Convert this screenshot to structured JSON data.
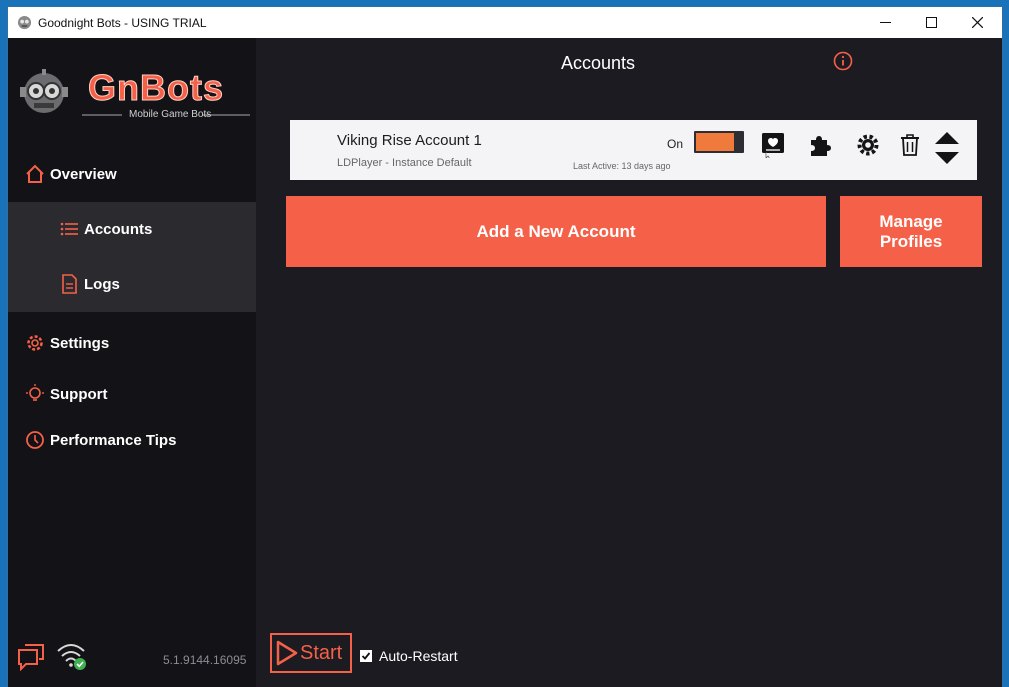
{
  "window": {
    "title": "Goodnight Bots  - USING TRIAL"
  },
  "logo": {
    "text": "GnBots",
    "tagline": "Mobile Game Bots"
  },
  "sidebar": {
    "items": [
      {
        "label": "Overview",
        "icon": "home-icon"
      },
      {
        "label": "Accounts",
        "icon": "list-icon"
      },
      {
        "label": "Logs",
        "icon": "document-icon"
      },
      {
        "label": "Settings",
        "icon": "gear-icon"
      },
      {
        "label": "Support",
        "icon": "lightbulb-icon"
      },
      {
        "label": "Performance Tips",
        "icon": "clock-icon"
      }
    ],
    "version": "5.1.9144.16095"
  },
  "main": {
    "title": "Accounts",
    "account": {
      "name": "Viking Rise Account 1",
      "instance": "LDPlayer - Instance Default",
      "last_active": "Last Active: 13 days ago",
      "status_label": "On"
    },
    "add_button": "Add a New Account",
    "manage_button": "Manage Profiles",
    "start_button": "Start",
    "auto_restart_label": "Auto-Restart"
  },
  "colors": {
    "accent": "#f56148",
    "toggle_on": "#f07a3c",
    "sidebar_bg": "#131216",
    "main_bg": "#1c1b21"
  }
}
